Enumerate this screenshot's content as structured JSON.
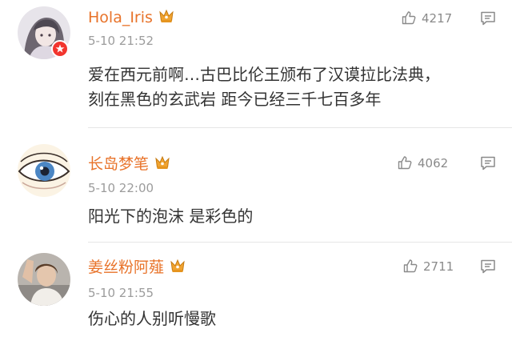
{
  "comments": [
    {
      "username": "Hola_Iris",
      "timestamp": "5-10 21:52",
      "likes": "4217",
      "lines": [
        "爱在西元前啊…古巴比伦王颁布了汉谟拉比法典，",
        "刻在黑色的玄武岩 距今已经三千七百多年"
      ],
      "avatar_icon": "anime-girl-avatar",
      "verified_badge": true
    },
    {
      "username": "长岛梦笔",
      "timestamp": "5-10 22:00",
      "likes": "4062",
      "lines": [
        "阳光下的泡沫 是彩色的"
      ],
      "avatar_icon": "eye-drawing-avatar",
      "verified_badge": false
    },
    {
      "username": "姜丝粉阿薤",
      "timestamp": "5-10 21:55",
      "likes": "2711",
      "lines": [
        "伤心的人别听慢歌"
      ],
      "avatar_icon": "waving-girl-photo-avatar",
      "verified_badge": false
    }
  ],
  "colors": {
    "username": "#e8732a",
    "timestamp": "#9c9c9c",
    "text": "#333333",
    "icon": "#8a8a8a",
    "crown": "#f0a330",
    "verified_badge": "#f2352e"
  },
  "icons": {
    "member": "crown-member-icon",
    "like": "thumbs-up-icon",
    "reply": "comment-reply-icon"
  }
}
